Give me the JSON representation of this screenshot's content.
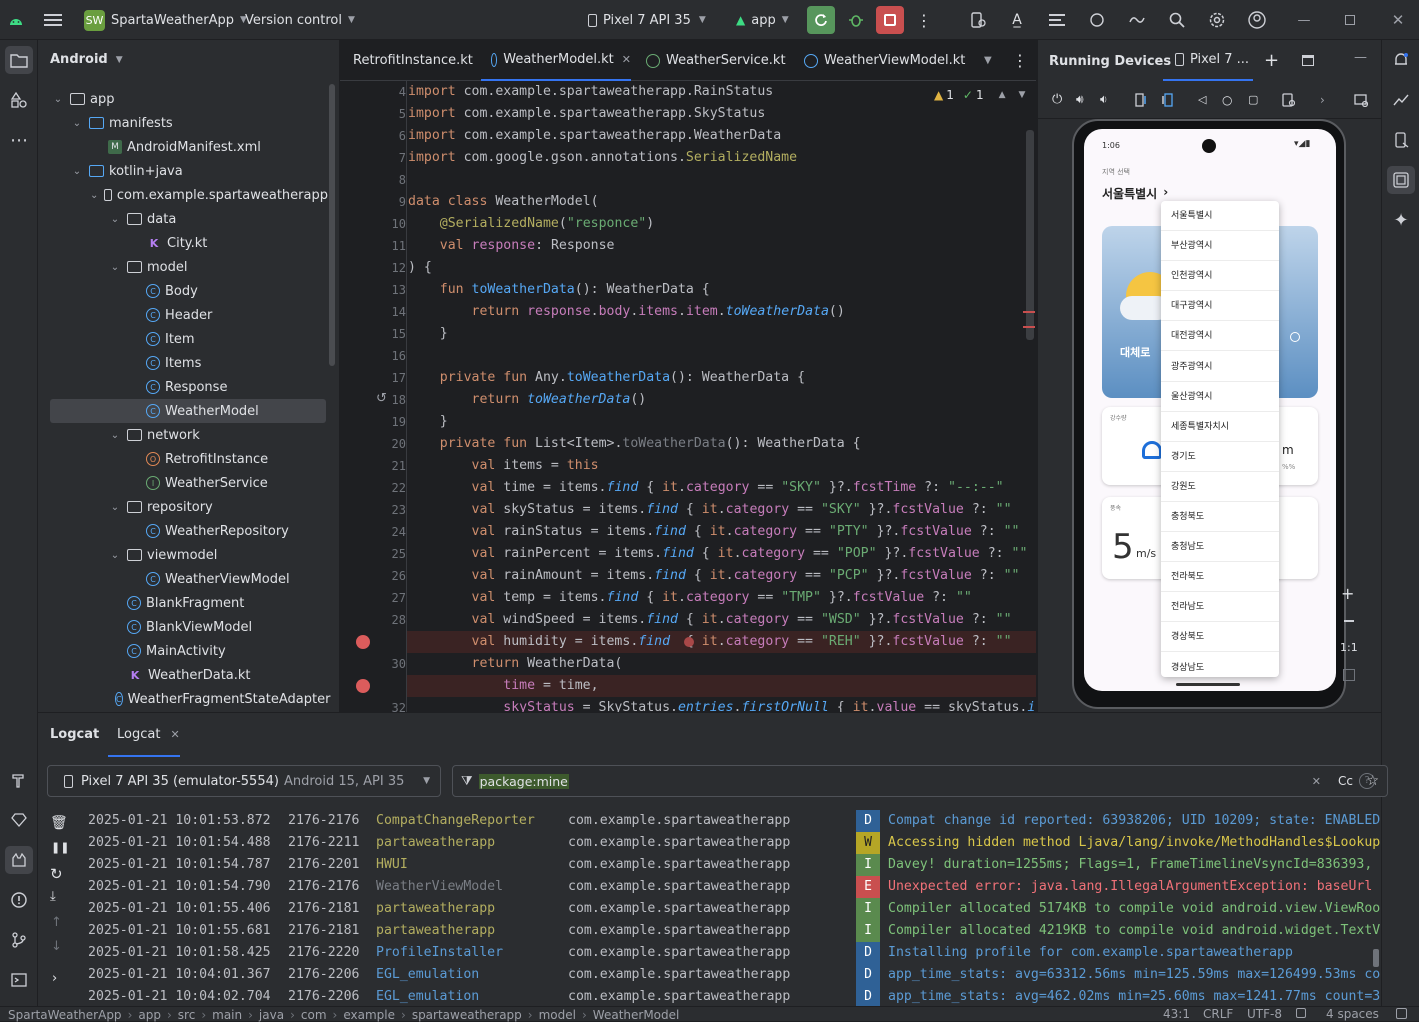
{
  "titlebar": {
    "app_badge": "SW",
    "project_name": "SpartaWeatherApp",
    "vcs": "Version control",
    "device": "Pixel 7 API 35",
    "run_config": "app"
  },
  "project_panel": {
    "title": "Android",
    "tree": [
      {
        "label": "app",
        "depth": 0,
        "icon": "module",
        "chev": "down"
      },
      {
        "label": "manifests",
        "depth": 1,
        "icon": "folder",
        "chev": "down"
      },
      {
        "label": "AndroidManifest.xml",
        "depth": 2,
        "icon": "manifest",
        "chev": ""
      },
      {
        "label": "kotlin+java",
        "depth": 1,
        "icon": "folder",
        "chev": "down"
      },
      {
        "label": "com.example.spartaweatherapp",
        "depth": 2,
        "icon": "package",
        "chev": "down"
      },
      {
        "label": "data",
        "depth": 3,
        "icon": "package",
        "chev": "down"
      },
      {
        "label": "City.kt",
        "depth": 4,
        "icon": "kotlin-file",
        "chev": ""
      },
      {
        "label": "model",
        "depth": 3,
        "icon": "package",
        "chev": "down"
      },
      {
        "label": "Body",
        "depth": 4,
        "icon": "class",
        "chev": ""
      },
      {
        "label": "Header",
        "depth": 4,
        "icon": "class",
        "chev": ""
      },
      {
        "label": "Item",
        "depth": 4,
        "icon": "class",
        "chev": ""
      },
      {
        "label": "Items",
        "depth": 4,
        "icon": "class",
        "chev": ""
      },
      {
        "label": "Response",
        "depth": 4,
        "icon": "class",
        "chev": ""
      },
      {
        "label": "WeatherModel",
        "depth": 4,
        "icon": "class",
        "chev": "",
        "selected": true
      },
      {
        "label": "network",
        "depth": 3,
        "icon": "package",
        "chev": "down"
      },
      {
        "label": "RetrofitInstance",
        "depth": 4,
        "icon": "object",
        "chev": ""
      },
      {
        "label": "WeatherService",
        "depth": 4,
        "icon": "interface",
        "chev": ""
      },
      {
        "label": "repository",
        "depth": 3,
        "icon": "package",
        "chev": "down"
      },
      {
        "label": "WeatherRepository",
        "depth": 4,
        "icon": "class",
        "chev": ""
      },
      {
        "label": "viewmodel",
        "depth": 3,
        "icon": "package",
        "chev": "down"
      },
      {
        "label": "WeatherViewModel",
        "depth": 4,
        "icon": "class",
        "chev": ""
      },
      {
        "label": "BlankFragment",
        "depth": 3,
        "icon": "class",
        "chev": ""
      },
      {
        "label": "BlankViewModel",
        "depth": 3,
        "icon": "class",
        "chev": ""
      },
      {
        "label": "MainActivity",
        "depth": 3,
        "icon": "class",
        "chev": ""
      },
      {
        "label": "WeatherData.kt",
        "depth": 3,
        "icon": "kotlin-file",
        "chev": ""
      },
      {
        "label": "WeatherFragmentStateAdapter",
        "depth": 3,
        "icon": "class",
        "chev": ""
      }
    ]
  },
  "editor": {
    "tabs": [
      "RetrofitInstance.kt",
      "WeatherModel.kt",
      "WeatherService.kt",
      "WeatherViewModel.kt"
    ],
    "active_tab": "WeatherModel.kt",
    "inspections": {
      "warnings": "1",
      "ok": "1"
    },
    "line_numbers": [
      "4",
      "5",
      "6",
      "7",
      "8",
      "9",
      "10",
      "11",
      "12",
      "13",
      "14",
      "15",
      "16",
      "17",
      "18",
      "19",
      "20",
      "21",
      "22",
      "23",
      "24",
      "25",
      "26",
      "27",
      "28",
      "",
      "30",
      "",
      "32"
    ],
    "code": [
      [
        [
          "kw",
          "import "
        ],
        [
          "",
          "com.example.spartaweatherapp.RainStatus"
        ]
      ],
      [
        [
          "kw",
          "import "
        ],
        [
          "",
          "com.example.spartaweatherapp.SkyStatus"
        ]
      ],
      [
        [
          "kw",
          "import "
        ],
        [
          "",
          "com.example.spartaweatherapp.WeatherData"
        ]
      ],
      [
        [
          "kw",
          "import "
        ],
        [
          "",
          "com.google.gson.annotations."
        ],
        [
          "ann",
          "SerializedName"
        ]
      ],
      [],
      [
        [
          "kw",
          "data class "
        ],
        [
          "",
          "WeatherModel("
        ]
      ],
      [
        [
          "ann",
          "    @SerializedName"
        ],
        [
          "",
          "("
        ],
        [
          "str",
          "\"responce\""
        ],
        [
          "",
          ")"
        ]
      ],
      [
        [
          "kw",
          "    val "
        ],
        [
          "prop",
          "response"
        ],
        [
          "",
          ": Response"
        ]
      ],
      [
        [
          "",
          ") {"
        ]
      ],
      [
        [
          "kw",
          "    fun "
        ],
        [
          "fn",
          "toWeatherData"
        ],
        [
          "",
          "(): WeatherData {"
        ]
      ],
      [
        [
          "kw",
          "        return "
        ],
        [
          "prop",
          "response"
        ],
        [
          "",
          "."
        ],
        [
          "prop",
          "body"
        ],
        [
          "",
          "."
        ],
        [
          "prop",
          "items"
        ],
        [
          "",
          "."
        ],
        [
          "prop",
          "item"
        ],
        [
          "",
          "."
        ],
        [
          "it",
          "toWeatherData"
        ],
        [
          "",
          "()"
        ]
      ],
      [
        [
          "",
          "    }"
        ]
      ],
      [],
      [
        [
          "kw",
          "    private fun "
        ],
        [
          "",
          "Any."
        ],
        [
          "fn",
          "toWeatherData"
        ],
        [
          "",
          "(): WeatherData {"
        ]
      ],
      [
        [
          "kw",
          "        return "
        ],
        [
          "it",
          "toWeatherData"
        ],
        [
          "",
          "()"
        ]
      ],
      [
        [
          "",
          "    }"
        ]
      ],
      [
        [
          "kw",
          "    private fun "
        ],
        [
          "",
          "List<Item>."
        ],
        [
          "gray",
          "toWeatherData"
        ],
        [
          "",
          "(): WeatherData {"
        ]
      ],
      [
        [
          "kw",
          "        val "
        ],
        [
          "",
          "items = "
        ],
        [
          "kw",
          "this"
        ]
      ],
      [
        [
          "kw",
          "        val "
        ],
        [
          "",
          "time = items."
        ],
        [
          "it",
          "find"
        ],
        [
          "",
          " { "
        ],
        [
          "kw",
          "it"
        ],
        [
          "",
          "."
        ],
        [
          "prop",
          "category"
        ],
        [
          "",
          " == "
        ],
        [
          "str",
          "\"SKY\""
        ],
        [
          "",
          " }?."
        ],
        [
          "prop",
          "fcstTime"
        ],
        [
          "",
          " ?: "
        ],
        [
          "str",
          "\"--:--\""
        ]
      ],
      [
        [
          "kw",
          "        val "
        ],
        [
          "",
          "skyStatus = items."
        ],
        [
          "it",
          "find"
        ],
        [
          "",
          " { "
        ],
        [
          "kw",
          "it"
        ],
        [
          "",
          "."
        ],
        [
          "prop",
          "category"
        ],
        [
          "",
          " == "
        ],
        [
          "str",
          "\"SKY\""
        ],
        [
          "",
          " }?."
        ],
        [
          "prop",
          "fcstValue"
        ],
        [
          "",
          " ?: "
        ],
        [
          "str",
          "\"\""
        ]
      ],
      [
        [
          "kw",
          "        val "
        ],
        [
          "",
          "rainStatus = items."
        ],
        [
          "it",
          "find"
        ],
        [
          "",
          " { "
        ],
        [
          "kw",
          "it"
        ],
        [
          "",
          "."
        ],
        [
          "prop",
          "category"
        ],
        [
          "",
          " == "
        ],
        [
          "str",
          "\"PTY\""
        ],
        [
          "",
          " }?."
        ],
        [
          "prop",
          "fcstValue"
        ],
        [
          "",
          " ?: "
        ],
        [
          "str",
          "\"\""
        ]
      ],
      [
        [
          "kw",
          "        val "
        ],
        [
          "",
          "rainPercent = items."
        ],
        [
          "it",
          "find"
        ],
        [
          "",
          " { "
        ],
        [
          "kw",
          "it"
        ],
        [
          "",
          "."
        ],
        [
          "prop",
          "category"
        ],
        [
          "",
          " == "
        ],
        [
          "str",
          "\"POP\""
        ],
        [
          "",
          " }?."
        ],
        [
          "prop",
          "fcstValue"
        ],
        [
          "",
          " ?: "
        ],
        [
          "str",
          "\"\""
        ]
      ],
      [
        [
          "kw",
          "        val "
        ],
        [
          "",
          "rainAmount = items."
        ],
        [
          "it",
          "find"
        ],
        [
          "",
          " { "
        ],
        [
          "kw",
          "it"
        ],
        [
          "",
          "."
        ],
        [
          "prop",
          "category"
        ],
        [
          "",
          " == "
        ],
        [
          "str",
          "\"PCP\""
        ],
        [
          "",
          " }?."
        ],
        [
          "prop",
          "fcstValue"
        ],
        [
          "",
          " ?: "
        ],
        [
          "str",
          "\"\""
        ]
      ],
      [
        [
          "kw",
          "        val "
        ],
        [
          "",
          "temp = items."
        ],
        [
          "it",
          "find"
        ],
        [
          "",
          " { "
        ],
        [
          "kw",
          "it"
        ],
        [
          "",
          "."
        ],
        [
          "prop",
          "category"
        ],
        [
          "",
          " == "
        ],
        [
          "str",
          "\"TMP\""
        ],
        [
          "",
          " }?."
        ],
        [
          "prop",
          "fcstValue"
        ],
        [
          "",
          " ?: "
        ],
        [
          "str",
          "\"\""
        ]
      ],
      [
        [
          "kw",
          "        val "
        ],
        [
          "",
          "windSpeed = items."
        ],
        [
          "it",
          "find"
        ],
        [
          "",
          " { "
        ],
        [
          "kw",
          "it"
        ],
        [
          "",
          "."
        ],
        [
          "prop",
          "category"
        ],
        [
          "",
          " == "
        ],
        [
          "str",
          "\"WSD\""
        ],
        [
          "",
          " }?."
        ],
        [
          "prop",
          "fcstValue"
        ],
        [
          "",
          " ?: "
        ],
        [
          "str",
          "\"\""
        ]
      ],
      [
        [
          "kw",
          "        val "
        ],
        [
          "",
          "humidity = items."
        ],
        [
          "it",
          "find"
        ],
        [
          "",
          "  { "
        ],
        [
          "kw",
          "it"
        ],
        [
          "",
          "."
        ],
        [
          "prop",
          "category"
        ],
        [
          "",
          " == "
        ],
        [
          "str",
          "\"REH\""
        ],
        [
          "",
          " }?."
        ],
        [
          "prop",
          "fcstValue"
        ],
        [
          "",
          " ?: "
        ],
        [
          "str",
          "\"\""
        ]
      ],
      [
        [
          "kw",
          "        return "
        ],
        [
          "",
          "WeatherData("
        ]
      ],
      [
        [
          "prop",
          "            time"
        ],
        [
          "",
          " = time,"
        ]
      ],
      [
        [
          "prop",
          "            skyStatus"
        ],
        [
          "",
          " = SkyStatus."
        ],
        [
          "it",
          "entries"
        ],
        [
          "",
          "."
        ],
        [
          "it",
          "firstOrNull"
        ],
        [
          "",
          " { "
        ],
        [
          "kw",
          "it"
        ],
        [
          "",
          "."
        ],
        [
          "prop",
          "value"
        ],
        [
          "",
          " == skyStatus."
        ],
        [
          "it",
          "i"
        ]
      ]
    ],
    "breakpoint_lines": [
      25,
      27
    ],
    "error_line": 25
  },
  "running_devices": {
    "title": "Running Devices",
    "device_tab": "Pixel 7 ...",
    "zoom_ratio": "1:1",
    "phone": {
      "status_time": "1:06",
      "location_label": "지역 선택",
      "city": "서울특별시",
      "card_text": "대체로 ",
      "small_label1": "강수량",
      "rain_value": "m",
      "rain_sub": "%%",
      "small_label2": "풍속",
      "wind_value": "5",
      "wind_unit": "m/s",
      "dropdown": [
        "서울특별시",
        "부산광역시",
        "인천광역시",
        "대구광역시",
        "대전광역시",
        "광주광역시",
        "울산광역시",
        "세종특별자치시",
        "경기도",
        "강원도",
        "충청북도",
        "충청남도",
        "전라북도",
        "전라남도",
        "경상북도",
        "경상남도"
      ]
    }
  },
  "logcat": {
    "tabs": [
      "Logcat",
      "Logcat"
    ],
    "device_select": "Pixel 7 API 35 (emulator-5554)",
    "device_select_sub": "Android 15, API 35",
    "filter": "package:mine",
    "case_toggle": "Cc",
    "rows": [
      {
        "time": "2025-01-21 10:01:53.872",
        "pid": "2176-2176",
        "tag": "CompatChangeReporter",
        "pkg": "com.example.spartaweatherapp",
        "level": "D",
        "msg": "Compat change id reported: 63938206; UID 10209; state: ENABLED"
      },
      {
        "time": "2025-01-21 10:01:54.488",
        "pid": "2176-2211",
        "tag": "partaweatherapp",
        "pkg": "com.example.spartaweatherapp",
        "level": "W",
        "msg": "Accessing hidden method Ljava/lang/invoke/MethodHandles$Lookup"
      },
      {
        "time": "2025-01-21 10:01:54.787",
        "pid": "2176-2201",
        "tag": "HWUI",
        "pkg": "com.example.spartaweatherapp",
        "level": "I",
        "msg": "Davey! duration=1255ms; Flags=1, FrameTimelineVsyncId=836393, "
      },
      {
        "time": "2025-01-21 10:01:54.790",
        "pid": "2176-2176",
        "tag": "WeatherViewModel",
        "pkg": "com.example.spartaweatherapp",
        "level": "E",
        "msg": "Unexpected error: java.lang.IllegalArgumentException: baseUrl "
      },
      {
        "time": "2025-01-21 10:01:55.406",
        "pid": "2176-2181",
        "tag": "partaweatherapp",
        "pkg": "com.example.spartaweatherapp",
        "level": "I",
        "msg": "Compiler allocated 5174KB to compile void android.view.ViewRoo"
      },
      {
        "time": "2025-01-21 10:01:55.681",
        "pid": "2176-2181",
        "tag": "partaweatherapp",
        "pkg": "com.example.spartaweatherapp",
        "level": "I",
        "msg": "Compiler allocated 4219KB to compile void android.widget.TextV"
      },
      {
        "time": "2025-01-21 10:01:58.425",
        "pid": "2176-2220",
        "tag": "ProfileInstaller",
        "pkg": "com.example.spartaweatherapp",
        "level": "D",
        "msg": "Installing profile for com.example.spartaweatherapp"
      },
      {
        "time": "2025-01-21 10:04:01.367",
        "pid": "2176-2206",
        "tag": "EGL_emulation",
        "pkg": "com.example.spartaweatherapp",
        "level": "D",
        "msg": "app_time_stats: avg=63312.56ms min=125.59ms max=126499.53ms co"
      },
      {
        "time": "2025-01-21 10:04:02.704",
        "pid": "2176-2206",
        "tag": "EGL_emulation",
        "pkg": "com.example.spartaweatherapp",
        "level": "D",
        "msg": "app_time_stats: avg=462.02ms min=25.60ms max=1241.77ms count=3"
      }
    ]
  },
  "statusbar": {
    "breadcrumb": [
      "SpartaWeatherApp",
      "app",
      "src",
      "main",
      "java",
      "com",
      "example",
      "spartaweatherapp",
      "model",
      "WeatherModel"
    ],
    "position": "43:1",
    "line_sep": "CRLF",
    "encoding": "UTF-8",
    "indent": "4 spaces"
  },
  "colors": {
    "accent": "#3574f0",
    "error_bg": "#3a2323",
    "breakpoint": "#db5c5c",
    "level_D": "#2f6196",
    "level_W": "#b5a626",
    "level_I": "#5a8a4e",
    "level_E": "#c94f4f"
  }
}
